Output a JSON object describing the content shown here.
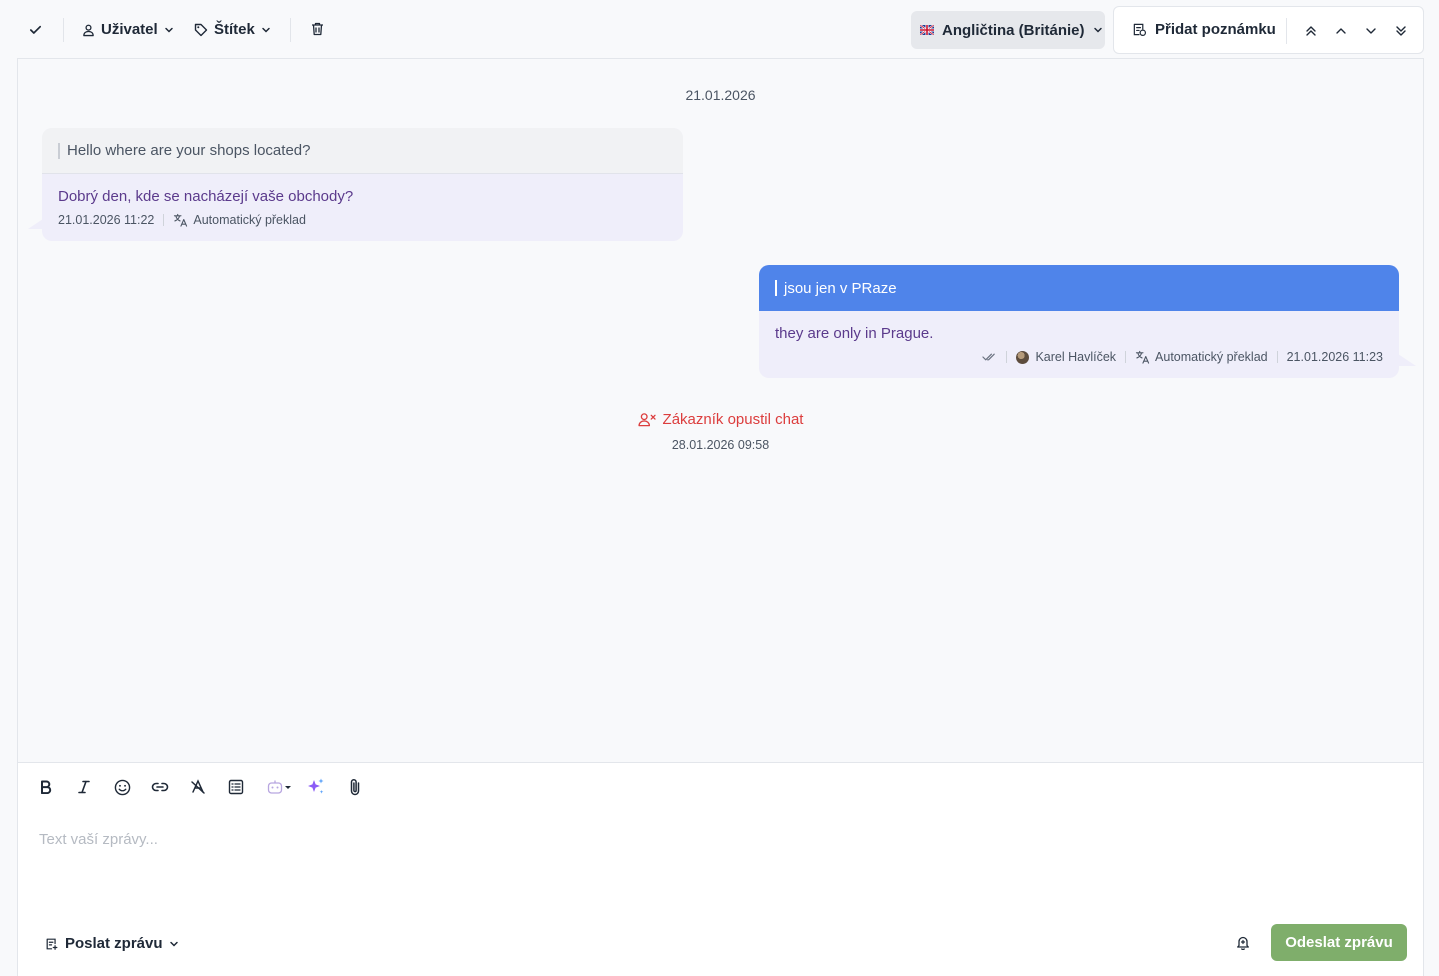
{
  "toolbar": {
    "user_label": "Uživatel",
    "tag_label": "Štítek",
    "language_label": "Angličtina (Británie)",
    "add_note_label": "Přidat poznámku"
  },
  "chat": {
    "date_separator": "21.01.2026",
    "messages": [
      {
        "direction": "incoming",
        "original": "Hello where are your shops located?",
        "translated": "Dobrý den, kde se nacházejí vaše obchody?",
        "time": "21.01.2026 11:22",
        "translation_label": "Automatický překlad"
      },
      {
        "direction": "outgoing",
        "original": "jsou jen v PRaze",
        "translated": "they are only in Prague.",
        "agent": "Karel Havlíček",
        "translation_label": "Automatický překlad",
        "time": "21.01.2026 11:23"
      }
    ],
    "event": {
      "text": "Zákazník opustil chat",
      "time": "28.01.2026 09:58"
    }
  },
  "composer": {
    "placeholder": "Text vaší zprávy...",
    "send_mode_label": "Poslat zprávu",
    "send_button_label": "Odeslat zprávu"
  },
  "colors": {
    "outgoing_header": "#4f84ea",
    "bubble_bg": "#efeefa",
    "translated_text": "#5b3a8c",
    "event_red": "#dc3d3d",
    "send_button": "#7fae6b",
    "ai_sparkle": "#8b5cf6"
  },
  "icons": [
    "check-icon",
    "user-icon",
    "tag-icon",
    "trash-icon",
    "uk-flag-icon",
    "note-icon",
    "double-chevron-up-icon",
    "chevron-up-icon",
    "chevron-down-icon",
    "double-chevron-down-icon",
    "translate-icon",
    "double-check-icon",
    "user-x-icon",
    "bold-icon",
    "italic-icon",
    "emoji-icon",
    "link-icon",
    "clear-format-icon",
    "template-icon",
    "bot-icon",
    "sparkles-icon",
    "paperclip-icon",
    "bell-icon"
  ]
}
